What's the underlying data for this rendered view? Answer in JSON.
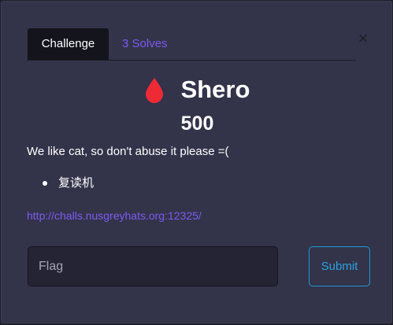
{
  "modal": {
    "close_label": "×"
  },
  "tabs": [
    {
      "label": "Challenge",
      "active": true
    },
    {
      "label": "3 Solves",
      "active": false
    }
  ],
  "challenge": {
    "name": "Shero",
    "points": "500",
    "description": "We like cat, so don't abuse it please =(",
    "hints": [
      "复读机"
    ],
    "link": "http://challs.nusgreyhats.org:12325/",
    "icon": "blood-drop-icon"
  },
  "form": {
    "flag_placeholder": "Flag",
    "flag_value": "",
    "submit_label": "Submit"
  },
  "colors": {
    "modal_bg": "#33334a",
    "accent_purple": "#7c5cf0",
    "blood_red": "#ee2a35",
    "submit_blue": "#1c9ad7"
  }
}
